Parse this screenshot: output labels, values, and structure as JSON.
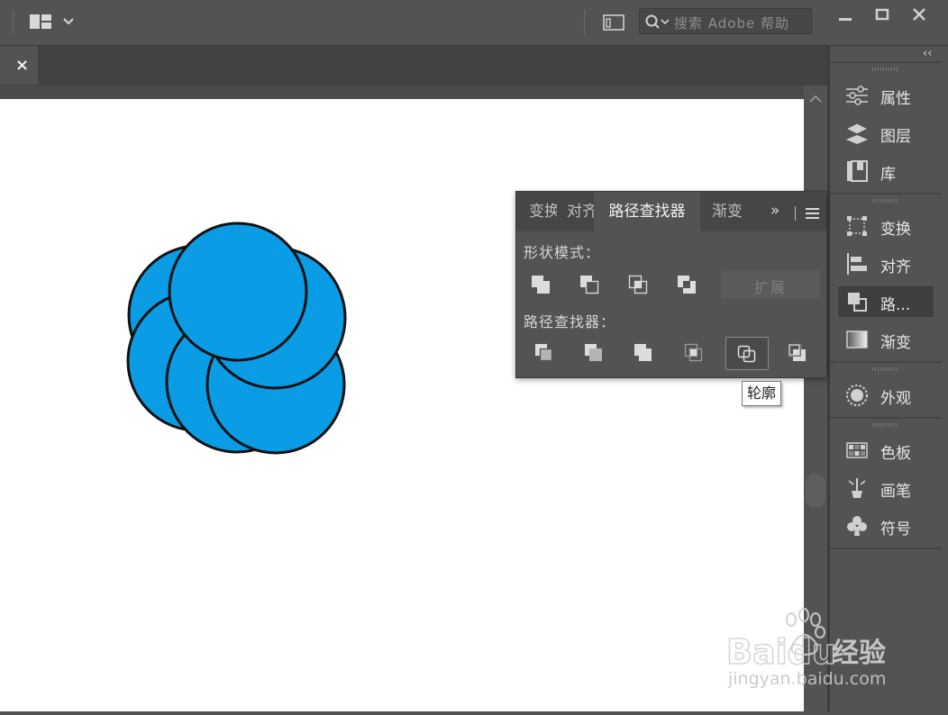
{
  "search": {
    "placeholder": "搜索 Adobe 帮助"
  },
  "document": {
    "close_label": "×"
  },
  "dock": {
    "items": [
      {
        "label": "属性",
        "icon": "properties-sliders-icon"
      },
      {
        "label": "图层",
        "icon": "layers-icon"
      },
      {
        "label": "库",
        "icon": "libraries-icon"
      },
      {
        "label": "变换",
        "icon": "transform-icon"
      },
      {
        "label": "对齐",
        "icon": "align-icon"
      },
      {
        "label": "路...",
        "icon": "pathfinder-icon",
        "active": true
      },
      {
        "label": "渐变",
        "icon": "gradient-icon"
      },
      {
        "label": "外观",
        "icon": "appearance-icon"
      },
      {
        "label": "色板",
        "icon": "swatches-icon"
      },
      {
        "label": "画笔",
        "icon": "brushes-icon"
      },
      {
        "label": "符号",
        "icon": "symbols-icon"
      }
    ],
    "collapse_label": "‹‹"
  },
  "pathfinder_panel": {
    "tabs": [
      {
        "label": "变换",
        "active": false
      },
      {
        "label": "对齐",
        "active": false
      },
      {
        "label": "路径查找器",
        "active": true
      },
      {
        "label": "渐变",
        "active": false
      }
    ],
    "overflow_label": "»",
    "shape_modes_title": "形状模式：",
    "shape_mode_buttons": [
      "unite-icon",
      "minus-front-icon",
      "intersect-icon",
      "exclude-icon"
    ],
    "expand_label": "扩展",
    "pathfinders_title": "路径查找器：",
    "pathfinder_buttons": [
      "divide-icon",
      "trim-icon",
      "merge-icon",
      "crop-icon",
      "outline-icon",
      "minus-back-icon"
    ],
    "tooltip": "轮廓"
  },
  "artwork": {
    "fill_color": "#0a9de6",
    "stroke_color": "#111111"
  },
  "watermark": {
    "brand": "Baidu",
    "product": "经验",
    "url": "jingyan.baidu.com"
  }
}
